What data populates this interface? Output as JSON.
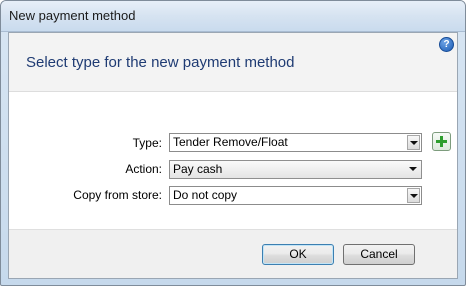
{
  "window": {
    "title": "New payment method"
  },
  "header": {
    "heading": "Select type for the new payment method",
    "help_icon": "help-icon"
  },
  "form": {
    "type_label": "Type:",
    "type_value": "Tender Remove/Float",
    "action_label": "Action:",
    "action_value": "Pay cash",
    "copy_label": "Copy from store:",
    "copy_value": "Do not copy",
    "add_icon": "plus-icon"
  },
  "footer": {
    "ok_label": "OK",
    "cancel_label": "Cancel"
  },
  "colors": {
    "heading": "#1f3b73",
    "plus": "#2e9e2e",
    "help": "#1c5cb5"
  }
}
